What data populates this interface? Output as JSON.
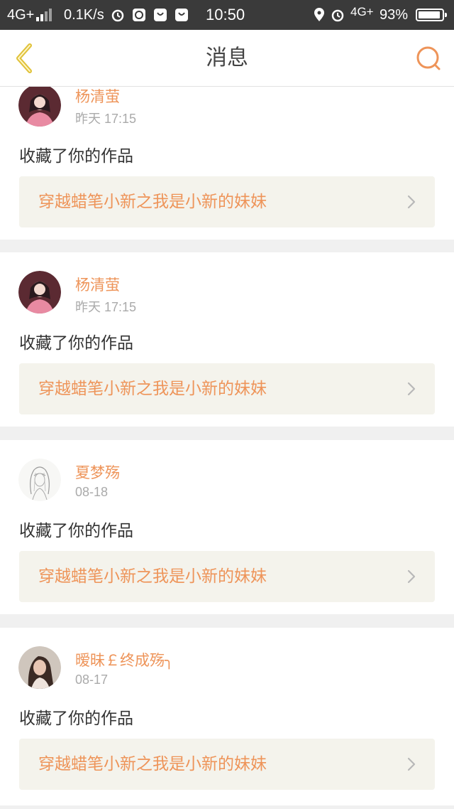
{
  "status_bar": {
    "network_left": "4G+",
    "speed": "0.1K/s",
    "time": "10:50",
    "network_right": "4G+",
    "battery": "93%",
    "battery_level": 0.93
  },
  "nav": {
    "title": "消息",
    "back_icon": "chevron-left-icon",
    "search_icon": "search-icon"
  },
  "colors": {
    "accent": "#ee9459",
    "back_icon": "#e0c23a",
    "link_bg": "#f4f3ec",
    "status_bg": "#3a3a3a"
  },
  "messages": [
    {
      "user": "杨清萤",
      "time": "昨天 17:15",
      "action": "收藏了你的作品",
      "work_title": "穿越蜡笔小新之我是小新的妹妹"
    },
    {
      "user": "杨清萤",
      "time": "昨天 17:15",
      "action": "收藏了你的作品",
      "work_title": "穿越蜡笔小新之我是小新的妹妹"
    },
    {
      "user": "夏梦殇",
      "time": "08-18",
      "action": "收藏了你的作品",
      "work_title": "穿越蜡笔小新之我是小新的妹妹"
    },
    {
      "user": "暧昧￡终成殇╮",
      "time": "08-17",
      "action": "收藏了你的作品",
      "work_title": "穿越蜡笔小新之我是小新的妹妹"
    }
  ]
}
